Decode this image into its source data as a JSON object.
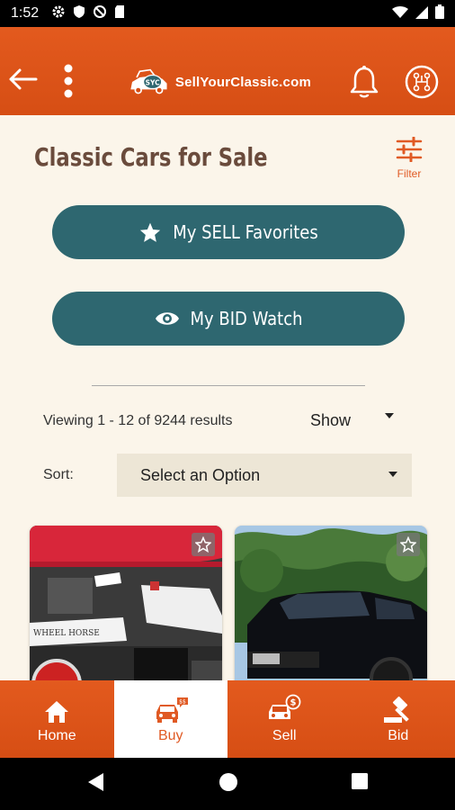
{
  "status_bar": {
    "time": "1:52"
  },
  "app_bar": {
    "logo_text": "SellYourClassic.com",
    "logo_badge": "SYC"
  },
  "page": {
    "title": "Classic Cars for Sale",
    "filter_label": "Filter"
  },
  "buttons": {
    "sell_favorites": "My SELL Favorites",
    "bid_watch": "My BID Watch"
  },
  "results": {
    "viewing_text": "Viewing 1 - 12 of 9244 results",
    "show_label": "Show"
  },
  "sort": {
    "label": "Sort:",
    "selected": "Select an Option"
  },
  "listings": [
    {
      "image_text": "WHEEL HORSE"
    },
    {
      "image_text": ""
    }
  ],
  "bottom_nav": [
    {
      "label": "Home",
      "icon": "home-icon",
      "active": false
    },
    {
      "label": "Buy",
      "icon": "buy-car-icon",
      "active": true
    },
    {
      "label": "Sell",
      "icon": "sell-car-icon",
      "active": false
    },
    {
      "label": "Bid",
      "icon": "gavel-icon",
      "active": false
    }
  ],
  "colors": {
    "brand_orange": "#e35a1e",
    "teal": "#2e6770",
    "cream": "#fbf5ea",
    "title_brown": "#6a4b3c"
  }
}
